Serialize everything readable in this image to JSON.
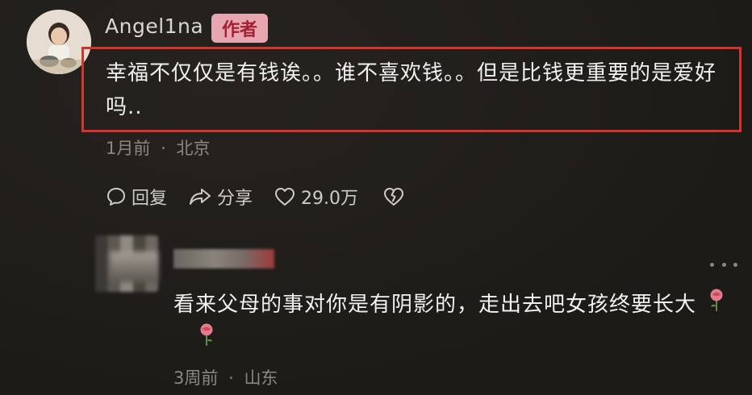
{
  "comment": {
    "username": "Angel1na",
    "author_badge": "作者",
    "text": "幸福不仅仅是有钱诶。。谁不喜欢钱。。但是比钱更重要的是爱好吗..",
    "time": "1月前",
    "separator": "·",
    "location": "北京",
    "actions": {
      "reply": "回复",
      "share": "分享",
      "likes": "29.0万"
    },
    "highlight_color": "#d8322d"
  },
  "reply": {
    "text": "看来父母的事对你是有阴影的，走出去吧女孩终要长大",
    "emojis": [
      "rose-icon",
      "rose-icon"
    ],
    "time": "3周前",
    "separator": "·",
    "location": "山东"
  },
  "colors": {
    "badge_bg": "#e8a6b1",
    "badge_text": "#a31f33",
    "meta_text": "#8b8883"
  }
}
